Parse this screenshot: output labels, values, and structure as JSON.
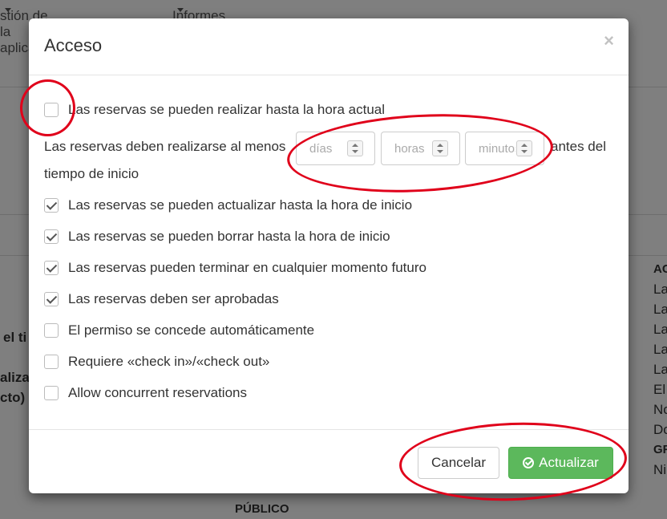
{
  "background": {
    "nav": {
      "item1": "stión de la aplicación",
      "item2": "Informes"
    },
    "left_frag1": "el ti",
    "left_frag2": "aliza",
    "left_frag3": "cto) ",
    "bottom_label": "PÚBLICO",
    "right_frags": [
      "AC",
      "La",
      "La",
      "La",
      "La",
      "La",
      "El",
      "No",
      "Do",
      "GR",
      "Ni"
    ]
  },
  "modal": {
    "title": "Acceso",
    "close": "×",
    "rows": [
      {
        "label": "Las reservas se pueden realizar hasta la hora actual",
        "checked": false
      },
      {
        "label": "Las reservas se pueden actualizar hasta la hora de inicio",
        "checked": true
      },
      {
        "label": "Las reservas se pueden borrar hasta la hora de inicio",
        "checked": true
      },
      {
        "label": "Las reservas pueden terminar en cualquier momento futuro",
        "checked": true
      },
      {
        "label": "Las reservas deben ser aprobadas",
        "checked": true
      },
      {
        "label": "El permiso se concede automáticamente",
        "checked": false
      },
      {
        "label": "Requiere «check in»/«check out»",
        "checked": false
      },
      {
        "label": "Allow concurrent reservations",
        "checked": false
      }
    ],
    "minimum": {
      "before": "Las reservas deben realizarse al menos",
      "after1": "antes del",
      "after2": "tiempo de inicio",
      "days_placeholder": "días",
      "hours_placeholder": "horas",
      "minutes_placeholder": "minutos"
    },
    "footer": {
      "cancel": "Cancelar",
      "update": "Actualizar"
    }
  },
  "colors": {
    "success": "#5cb85c",
    "annotation": "#e0001a"
  }
}
